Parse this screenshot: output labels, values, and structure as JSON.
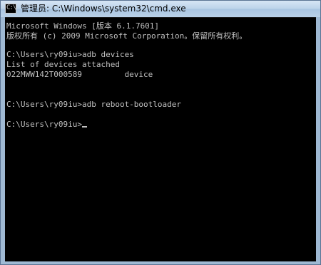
{
  "window": {
    "title": "管理员: C:\\Windows\\system32\\cmd.exe",
    "icon": "cmd-icon",
    "icon_glyph": "C:\\"
  },
  "console": {
    "lines": [
      "Microsoft Windows [版本 6.1.7601]",
      "版权所有 (c) 2009 Microsoft Corporation。保留所有权利。",
      "",
      "C:\\Users\\ry09iu>adb devices",
      "List of devices attached",
      "022MWW142T000589         device",
      "",
      "",
      "C:\\Users\\ry09iu>adb reboot-bootloader",
      "",
      "C:\\Users\\ry09iu>"
    ]
  },
  "colors": {
    "console_background": "#000000",
    "console_text": "#c0c0c0",
    "titlebar": "#bcd3ea"
  }
}
